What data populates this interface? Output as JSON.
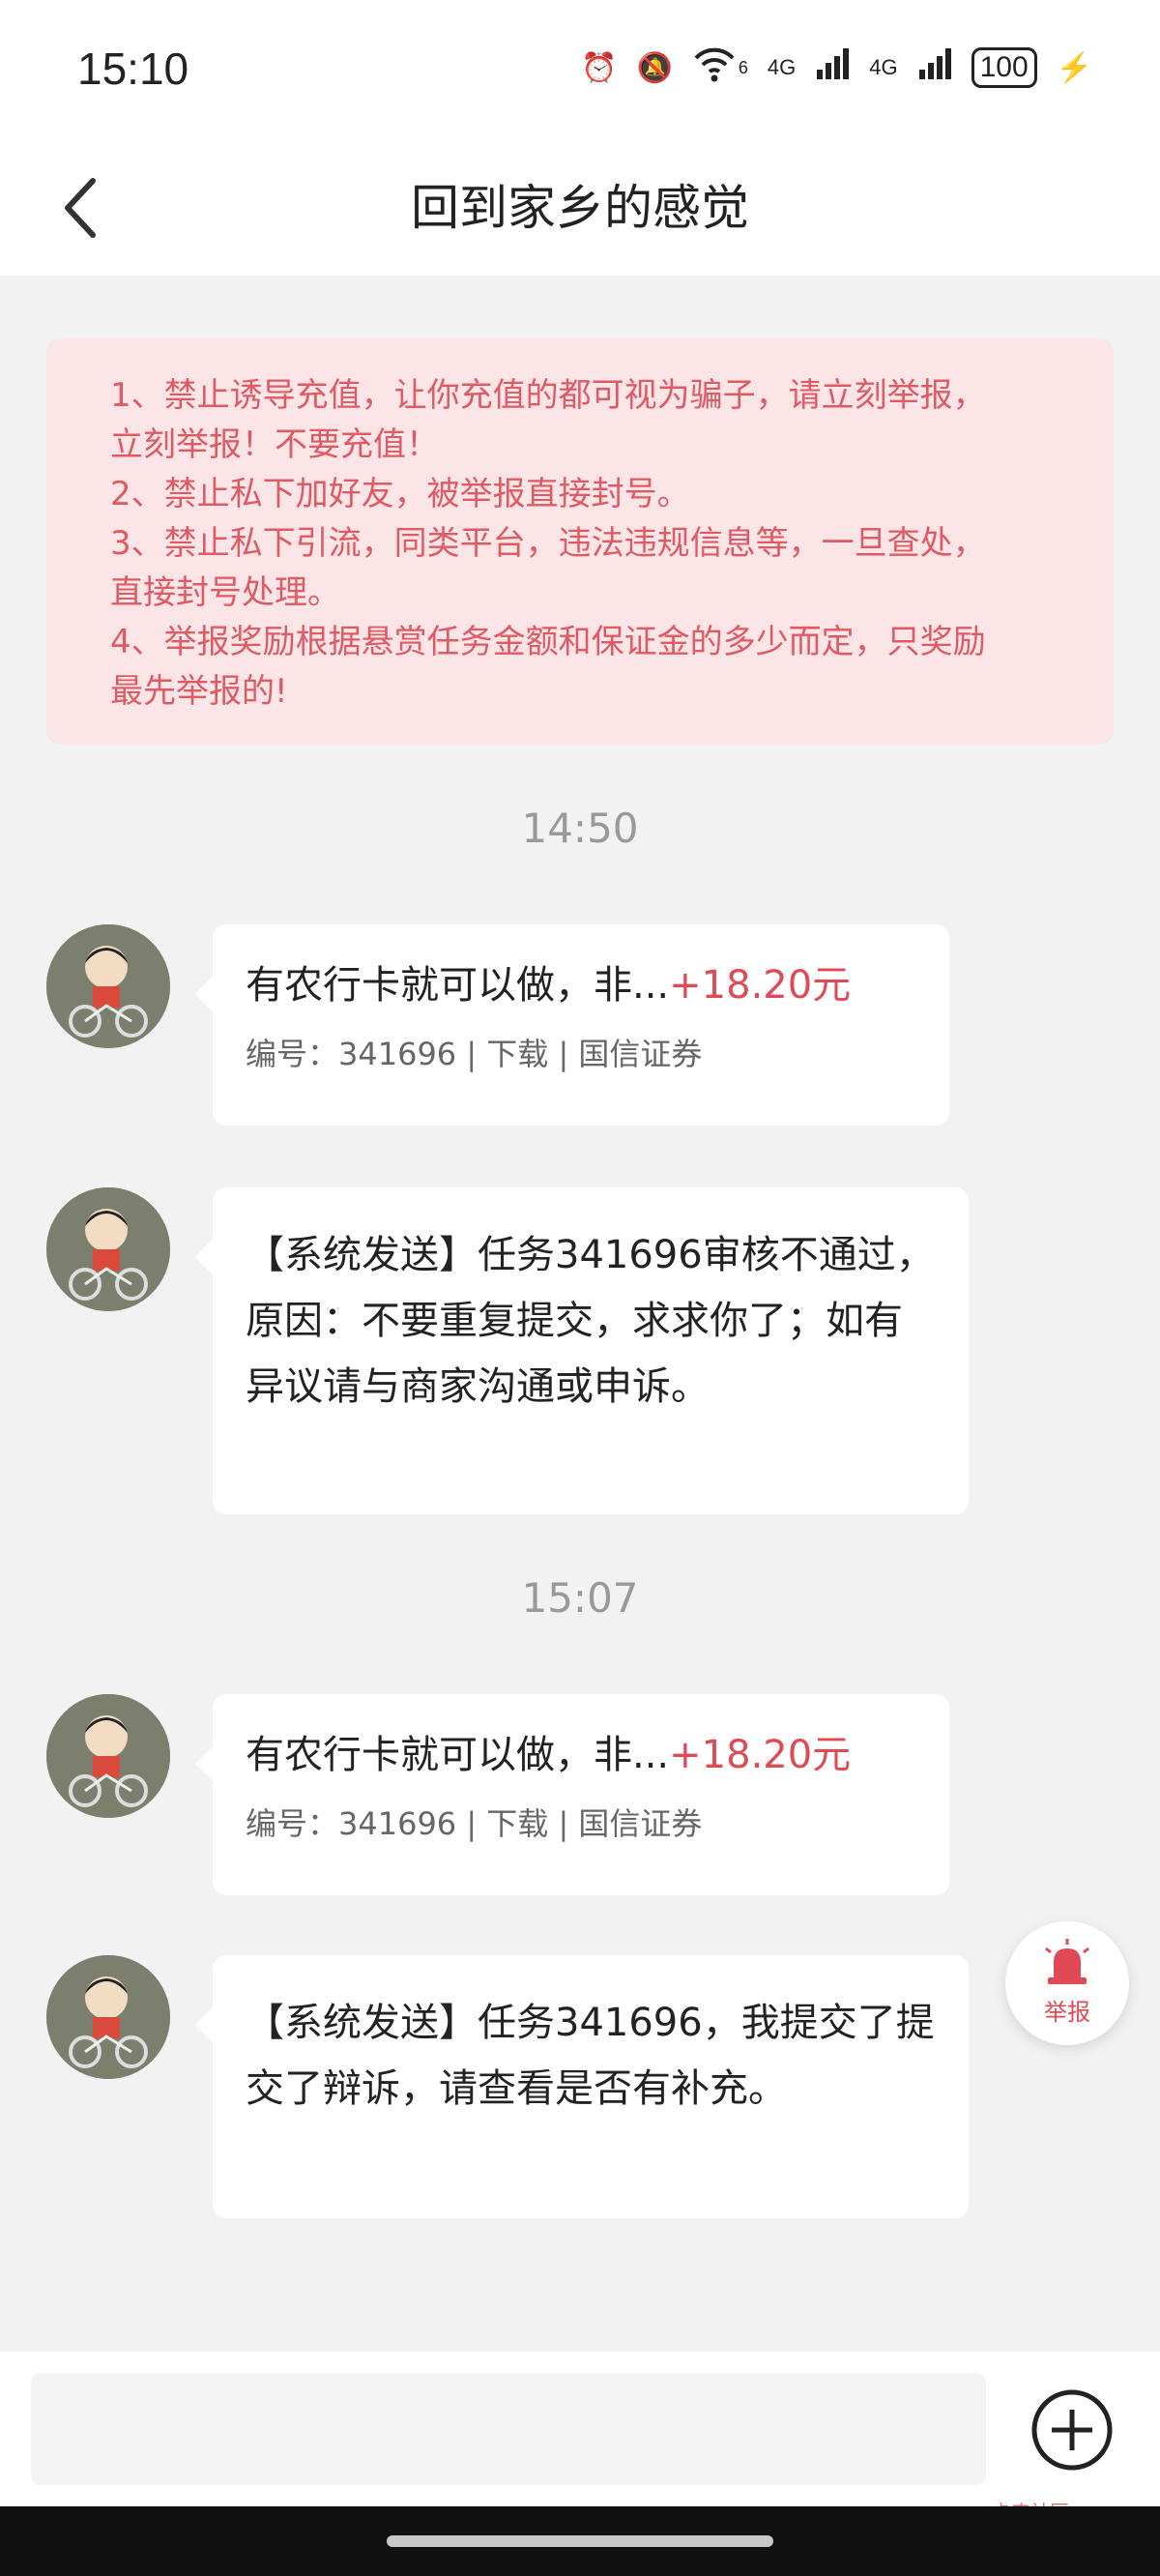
{
  "status_bar": {
    "time": "15:10",
    "network1": "4G",
    "network2": "4G",
    "wifi_badge": "6",
    "battery": "100"
  },
  "header": {
    "title": "回到家乡的感觉"
  },
  "notice": {
    "lines": [
      "1、禁止诱导充值，让你充值的都可视为骗子，请立刻举报，",
      "立刻举报！不要充值！",
      "2、禁止私下加好友，被举报直接封号。",
      "3、禁止私下引流，同类平台，违法违规信息等，一旦查处，",
      "直接封号处理。",
      "4、举报奖励根据悬赏任务金额和保证金的多少而定，只奖励",
      "最先举报的!"
    ]
  },
  "messages": {
    "time1": "14:50",
    "time2": "15:07",
    "task1": {
      "title": "有农行卡就可以做，非...",
      "amount": "+18.20元",
      "meta": "编号：341696 | 下载 | 国信证券"
    },
    "sys1": "【系统发送】任务341696审核不通过，原因：不要重复提交，求求你了；如有异议请与商家沟通或申诉。",
    "task2": {
      "title": "有农行卡就可以做，非...",
      "amount": "+18.20元",
      "meta": "编号：341696 | 下载 | 国信证券"
    },
    "sys2": "【系统发送】任务341696，我提交了提交了辩诉，请查看是否有补充。"
  },
  "report": {
    "label": "举报"
  },
  "input": {
    "value": "",
    "placeholder": ""
  },
  "watermark": "卡农社区",
  "colors": {
    "accent": "#e04a55",
    "notice_bg": "#fbe5e7",
    "notice_text": "#e05a63"
  },
  "icons": {
    "back": "chevron-left-icon",
    "report": "alarm-siren-icon",
    "add": "plus-circle-icon"
  }
}
